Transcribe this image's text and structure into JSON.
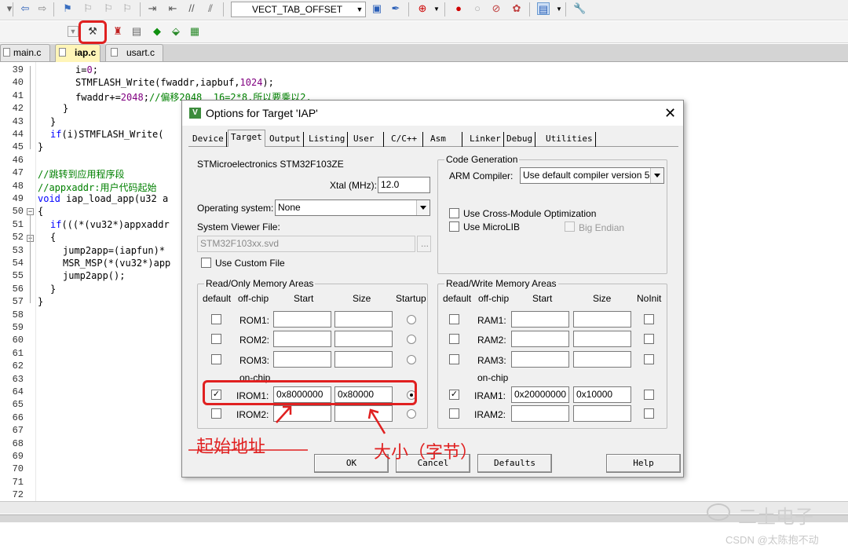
{
  "toolbar1": {
    "target_combo": "VECT_TAB_OFFSET"
  },
  "file_tabs": [
    "main.c",
    "iap.c",
    "usart.c"
  ],
  "editor": {
    "line_numbers": [
      "39",
      "40",
      "41",
      "42",
      "43",
      "44",
      "45",
      "46",
      "47",
      "48",
      "49",
      "50",
      "51",
      "52",
      "53",
      "54",
      "55",
      "56",
      "57",
      "58",
      "59",
      "60",
      "61",
      "62",
      "63",
      "64",
      "65",
      "66",
      "67",
      "68",
      "69",
      "70",
      "71",
      "72"
    ],
    "lines": [
      "i=0;",
      "STMFLASH_Write(fwaddr,iapbuf,1024);",
      "fwaddr+=2048;//偏移2048  16=2*8.所以要乘以2.",
      "}",
      "}",
      "if(i)STMFLASH_Write(",
      "}",
      "",
      "//跳转到应用程序段",
      "//appxaddr:用户代码起始",
      "void iap_load_app(u32 a",
      "{",
      "if(((*(vu32*)appxaddr",
      "{",
      "jump2app=(iapfun)*",
      "MSR_MSP(*(vu32*)app",
      "jump2app();",
      "}",
      "}"
    ]
  },
  "dialog": {
    "title": "Options for Target 'IAP'",
    "tabs": [
      "Device",
      "Target",
      "Output",
      "Listing",
      "User",
      "C/C++",
      "Asm",
      "Linker",
      "Debug",
      "Utilities"
    ],
    "active_tab": "Target",
    "device_name": "STMicroelectronics STM32F103ZE",
    "xtal_label": "Xtal (MHz):",
    "xtal_value": "12.0",
    "os_label": "Operating system:",
    "os_value": "None",
    "svf_label": "System Viewer File:",
    "svf_value": "STM32F103xx.svd",
    "svf_browse": "...",
    "use_custom_file": "Use Custom File",
    "code_gen": {
      "title": "Code Generation",
      "arm_compiler_label": "ARM Compiler:",
      "arm_compiler_value": "Use default compiler version 5",
      "cross_module": "Use Cross-Module Optimization",
      "microlib": "Use MicroLIB",
      "big_endian": "Big Endian"
    },
    "rom": {
      "title": "Read/Only Memory Areas",
      "headers": [
        "default",
        "off-chip",
        "Start",
        "Size",
        "Startup"
      ],
      "on_chip_label": "on-chip",
      "rows": [
        {
          "name": "ROM1:",
          "start": "",
          "size": "",
          "default": false,
          "startup": false
        },
        {
          "name": "ROM2:",
          "start": "",
          "size": "",
          "default": false,
          "startup": false
        },
        {
          "name": "ROM3:",
          "start": "",
          "size": "",
          "default": false,
          "startup": false
        },
        {
          "name": "IROM1:",
          "start": "0x8000000",
          "size": "0x80000",
          "default": true,
          "startup": true
        },
        {
          "name": "IROM2:",
          "start": "",
          "size": "",
          "default": false,
          "startup": false
        }
      ]
    },
    "ram": {
      "title": "Read/Write Memory Areas",
      "headers": [
        "default",
        "off-chip",
        "Start",
        "Size",
        "NoInit"
      ],
      "on_chip_label": "on-chip",
      "rows": [
        {
          "name": "RAM1:",
          "start": "",
          "size": "",
          "default": false
        },
        {
          "name": "RAM2:",
          "start": "",
          "size": "",
          "default": false
        },
        {
          "name": "RAM3:",
          "start": "",
          "size": "",
          "default": false
        },
        {
          "name": "IRAM1:",
          "start": "0x20000000",
          "size": "0x10000",
          "default": true
        },
        {
          "name": "IRAM2:",
          "start": "",
          "size": "",
          "default": false
        }
      ]
    },
    "buttons": {
      "ok": "OK",
      "cancel": "Cancel",
      "defaults": "Defaults",
      "help": "Help"
    }
  },
  "annotations": {
    "start_address": "起始地址",
    "size_bytes": "大小（字节）"
  },
  "watermark": {
    "brand": "二土电子",
    "csdn": "CSDN @太陈抱不动"
  },
  "colors": {
    "annotation_red": "#e02020",
    "keyword_blue": "#0000ff",
    "comment_green": "#008000",
    "number_purple": "#800080"
  }
}
